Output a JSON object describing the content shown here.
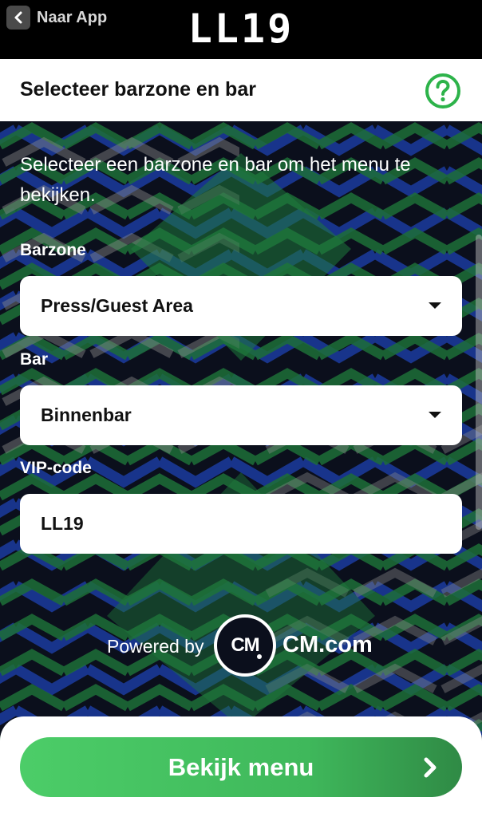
{
  "topbar": {
    "back_label": "Naar App",
    "logo_text": "LL19"
  },
  "header": {
    "title": "Selecteer barzone en bar",
    "help_icon": "question-circle-icon",
    "accent": "#2db34a"
  },
  "form": {
    "intro": "Selecteer een barzone en bar om het menu te bekijken.",
    "barzone": {
      "label": "Barzone",
      "value": "Press/Guest Area"
    },
    "bar": {
      "label": "Bar",
      "value": "Binnenbar"
    },
    "vip": {
      "label": "VIP-code",
      "value": "LL19"
    }
  },
  "footer": {
    "powered_by": "Powered by",
    "cm_logo": "CM",
    "cm_brand": "CM.com"
  },
  "cta": {
    "label": "Bekijk menu",
    "colors": [
      "#4ccd68",
      "#2f8a45"
    ]
  }
}
